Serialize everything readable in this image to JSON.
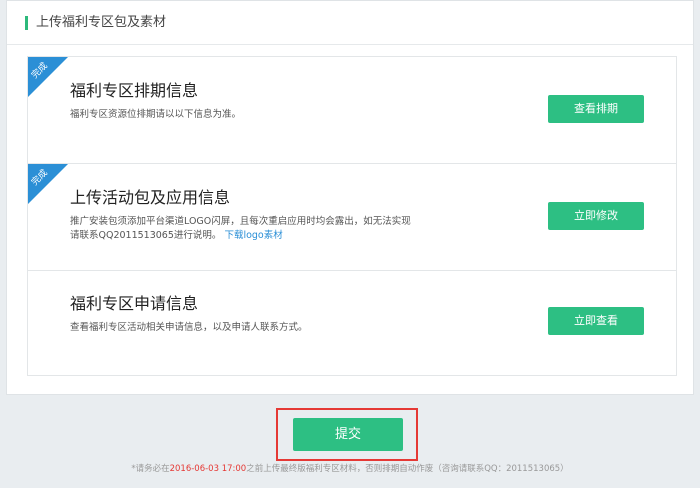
{
  "section": {
    "title": "上传福利专区包及素材"
  },
  "cards": [
    {
      "ribbon": "完成",
      "title": "福利专区排期信息",
      "desc": "福利专区资源位排期请以以下信息为准。",
      "button": "查看排期"
    },
    {
      "ribbon": "完成",
      "title": "上传活动包及应用信息",
      "desc_line1": "推广安装包须添加平台渠道LOGO闪屏，且每次重启应用时均会露出，如无法实现",
      "desc_line2": "请联系QQ2011513065进行说明。",
      "link": "下载logo素材",
      "button": "立即修改"
    },
    {
      "title": "福利专区申请信息",
      "desc": "查看福利专区活动相关申请信息，以及申请人联系方式。",
      "button": "立即查看"
    }
  ],
  "submit": {
    "label": "提交"
  },
  "notice": {
    "prefix": "*请务必在",
    "deadline": "2016-06-03 17:00",
    "suffix": "之前上传最终版福利专区材料，否则排期自动作废（咨询请联系QQ：2011513065）"
  },
  "colors": {
    "accent": "#2dbf83",
    "ribbon": "#2b8fd6",
    "warning": "#e53935",
    "link": "#2b8fd6"
  }
}
